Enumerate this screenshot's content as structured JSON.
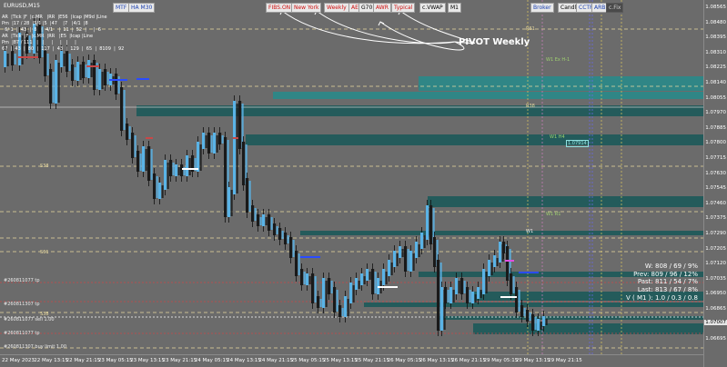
{
  "window": {
    "symbol": "EURUSD,M15"
  },
  "toolbar": {
    "buttons": [
      {
        "label": "MTF",
        "style": "blue"
      },
      {
        "label": "HA M30",
        "style": "blue"
      },
      {
        "label": "FIBS.ON",
        "style": "red"
      },
      {
        "label": "New York",
        "style": "red"
      },
      {
        "label": "Weekly",
        "style": "red"
      },
      {
        "label": "AE",
        "style": "red"
      },
      {
        "label": "G70",
        "style": "black"
      },
      {
        "label": "AWR",
        "style": "red"
      },
      {
        "label": "Typical",
        "style": "red"
      },
      {
        "label": "c.VWAP",
        "style": "black"
      },
      {
        "label": "M1",
        "style": "black"
      },
      {
        "label": "Broker",
        "style": "blue"
      },
      {
        "label": "Candle",
        "style": "black"
      },
      {
        "label": "CCTF",
        "style": "blue"
      },
      {
        "label": "ARB",
        "style": "blue"
      },
      {
        "label": "c.Fix",
        "style": "dark"
      }
    ]
  },
  "annotation": {
    "pivot_label": "PIVOT Weekly"
  },
  "stats_panel": {
    "rows": [
      "AR  |Tick |F  |c.MR   |RR  |E56  |Icap |M9d |Line",
      "Pm  |17 / 28  |5/1 |5  |47    |7   |4/1  |8",
      "  6/ 1  |  43  |  8   |  4/1    |  11  |  52  |     |  6",
      "AR  |Tick  |F  |c.MR  |RR   |E5  |Icap |Line",
      "Pm  |87 / 111   |   |     |     |   |     |",
      "67  |  43  |  80  |  117  |  43  |  129  |  65  |  8109  |  92"
    ]
  },
  "info_panel": {
    "lines": [
      "W: 808 / 69 / 9%",
      "Prev: 809 / 96 / 12%",
      "Past: 811 / 54 / 7%",
      "Last: 813 / 67 / 8%",
      "V ( M1 ): 1.0 / 0.3 / 0.8"
    ]
  },
  "level_labels": {
    "s61": "S61",
    "s38": "S38",
    "r38": "R38",
    "r61": "R61",
    "w_h3": "W1 Ex H-1",
    "m_h4": "W1 H4",
    "m_r1": "W1 R1",
    "w1": "W1",
    "s38b": "S38",
    "fib_a": "#260811077 tp",
    "fib_b": "#260811307 tp",
    "fib_c": "#260811077 sell 1.00",
    "fib_d": "#260811077 tp",
    "fib_e": "#260811307 buy limit 1.00",
    "pill": "1.07914"
  },
  "y_axis": {
    "ticks": [
      "1.08565",
      "1.08480",
      "1.08395",
      "1.08310",
      "1.08225",
      "1.08140",
      "1.08055",
      "1.07970",
      "1.07885",
      "1.07800",
      "1.07715",
      "1.07630",
      "1.07545",
      "1.07460",
      "1.07375",
      "1.07290",
      "1.07205",
      "1.07120",
      "1.07035",
      "1.06950",
      "1.06865",
      "1.06780",
      "1.06695"
    ],
    "current_price": "1.07007"
  },
  "x_axis": {
    "ticks": [
      "22 May 2023",
      "22 May 13:15",
      "22 May 21:15",
      "23 May 05:15",
      "23 May 13:15",
      "23 May 21:15",
      "24 May 05:15",
      "24 May 13:15",
      "24 May 21:15",
      "25 May 05:15",
      "25 May 13:15",
      "25 May 21:15",
      "26 May 05:15",
      "26 May 13:15",
      "26 May 21:15",
      "29 May 05:15",
      "29 May 13:15",
      "29 May 21:15"
    ]
  },
  "colors": {
    "background": "#6b6b6b",
    "bull_body": "#5ab3e6",
    "bear_body": "#1a1a1a",
    "zone": "#1d5a5a",
    "zone_bright": "#2a8a8a",
    "fib_dash": "#e8d9a0",
    "red_level": "#c84848",
    "blue_seg": "#2a4cff",
    "white_dash": "#ffffff"
  }
}
